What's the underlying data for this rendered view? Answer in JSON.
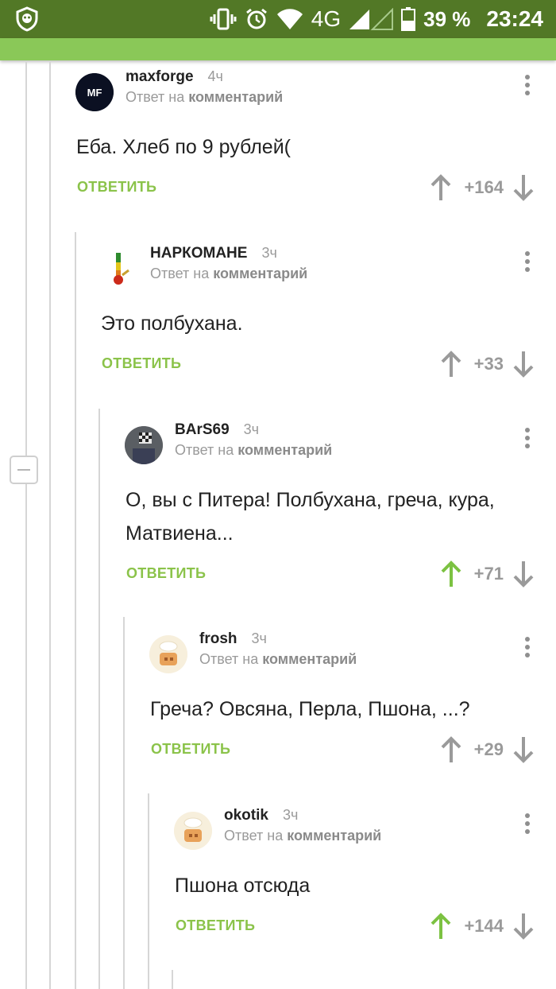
{
  "status_bar": {
    "network": "4G",
    "battery": "39 %",
    "time": "23:24"
  },
  "comments": [
    {
      "username": "maxforge",
      "time": "4ч",
      "reply_prefix": "Ответ на",
      "reply_target": "комментарий",
      "text_lines": [
        "Еба. Хлеб по 9 рублей("
      ],
      "reply_label": "ОТВЕТИТЬ",
      "rating": "+164",
      "upvoted": false,
      "avatar_text": "MF"
    },
    {
      "username": "НАРКОМАНЕ",
      "time": "3ч",
      "reply_prefix": "Ответ на",
      "reply_target": "комментарий",
      "text_lines": [
        "Это полбухана."
      ],
      "reply_label": "ОТВЕТИТЬ",
      "rating": "+33",
      "upvoted": false
    },
    {
      "username": "BArS69",
      "time": "3ч",
      "reply_prefix": "Ответ на",
      "reply_target": "комментарий",
      "text_lines": [
        "О, вы с Питера! Полбухана, греча, кура,",
        "Матвиена..."
      ],
      "reply_label": "ОТВЕТИТЬ",
      "rating": "+71",
      "upvoted": true
    },
    {
      "username": "frosh",
      "time": "3ч",
      "reply_prefix": "Ответ на",
      "reply_target": "комментарий",
      "text_lines": [
        "Греча? Овсяна, Перла, Пшона, ...?"
      ],
      "reply_label": "ОТВЕТИТЬ",
      "rating": "+29",
      "upvoted": false
    },
    {
      "username": "okotik",
      "time": "3ч",
      "reply_prefix": "Ответ на",
      "reply_target": "комментарий",
      "text_lines": [
        "Пшона отсюда"
      ],
      "reply_label": "ОТВЕТИТЬ",
      "rating": "+144",
      "upvoted": true
    }
  ],
  "colors": {
    "status_bar": "#527826",
    "accent": "#8bc34a",
    "upvote_active": "#7cc242",
    "arrow_inactive": "#9a9a9a"
  },
  "icons": [
    "app-shield-icon",
    "vibrate-icon",
    "alarm-icon",
    "wifi-icon",
    "signal-icon",
    "battery-icon",
    "more-vert-icon",
    "arrow-up-icon",
    "arrow-down-icon",
    "collapse-icon"
  ]
}
